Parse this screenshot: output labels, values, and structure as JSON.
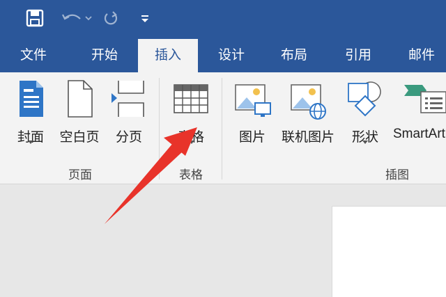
{
  "quick_access": {
    "save_icon": "save-icon",
    "undo_icon": "undo-icon",
    "redo_icon": "redo-icon",
    "customize_icon": "customize-quick-access-icon"
  },
  "tabs": [
    "文件",
    "开始",
    "插入",
    "设计",
    "布局",
    "引用",
    "邮件"
  ],
  "active_tab": "插入",
  "ribbon": {
    "pages_group": {
      "label": "页面",
      "cover": "封面",
      "blank_page": "空白页",
      "page_break": "分页"
    },
    "table_group": {
      "label": "表格",
      "table": "表格"
    },
    "illustrations_group": {
      "label": "插图",
      "pictures": "图片",
      "online_pictures": "联机图片",
      "shapes": "形状",
      "smartart": "SmartArt"
    }
  },
  "colors": {
    "brand_blue": "#2b579a",
    "ribbon_bg": "#f3f3f3",
    "workspace_bg": "#e7e7e7",
    "annotation_arrow": "#e8332a"
  }
}
